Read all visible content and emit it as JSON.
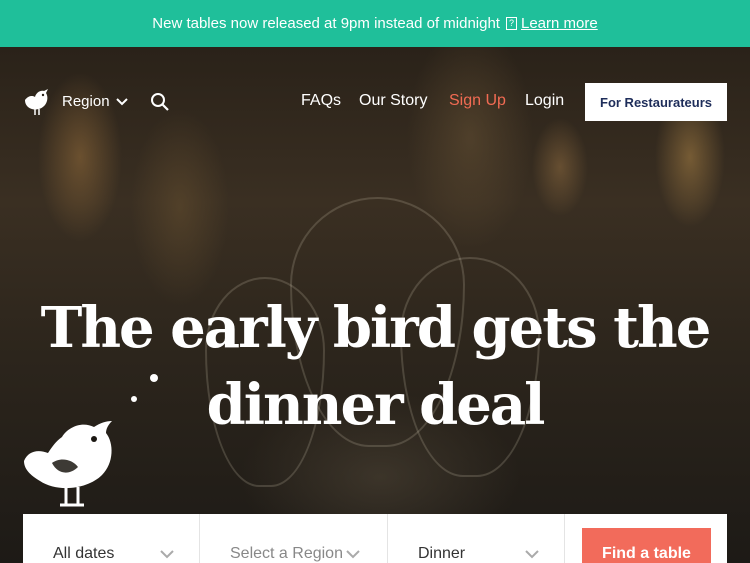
{
  "banner": {
    "message": "New tables now released at 9pm instead of midnight",
    "help_glyph": "?",
    "link_label": "Learn more",
    "bg_color": "#1fbf9a"
  },
  "nav": {
    "region_label": "Region",
    "links": [
      "FAQs",
      "Our Story",
      "Sign Up",
      "Login"
    ],
    "cta_label": "For Restaurateurs",
    "signup_color": "#f26b53"
  },
  "hero": {
    "headline_line1": "The early bird gets the",
    "headline_line2": "dinner deal"
  },
  "search": {
    "date_value": "All dates",
    "region_placeholder": "Select a Region",
    "meal_value": "Dinner",
    "submit_label": "Find a table",
    "submit_color": "#f26b5b"
  }
}
